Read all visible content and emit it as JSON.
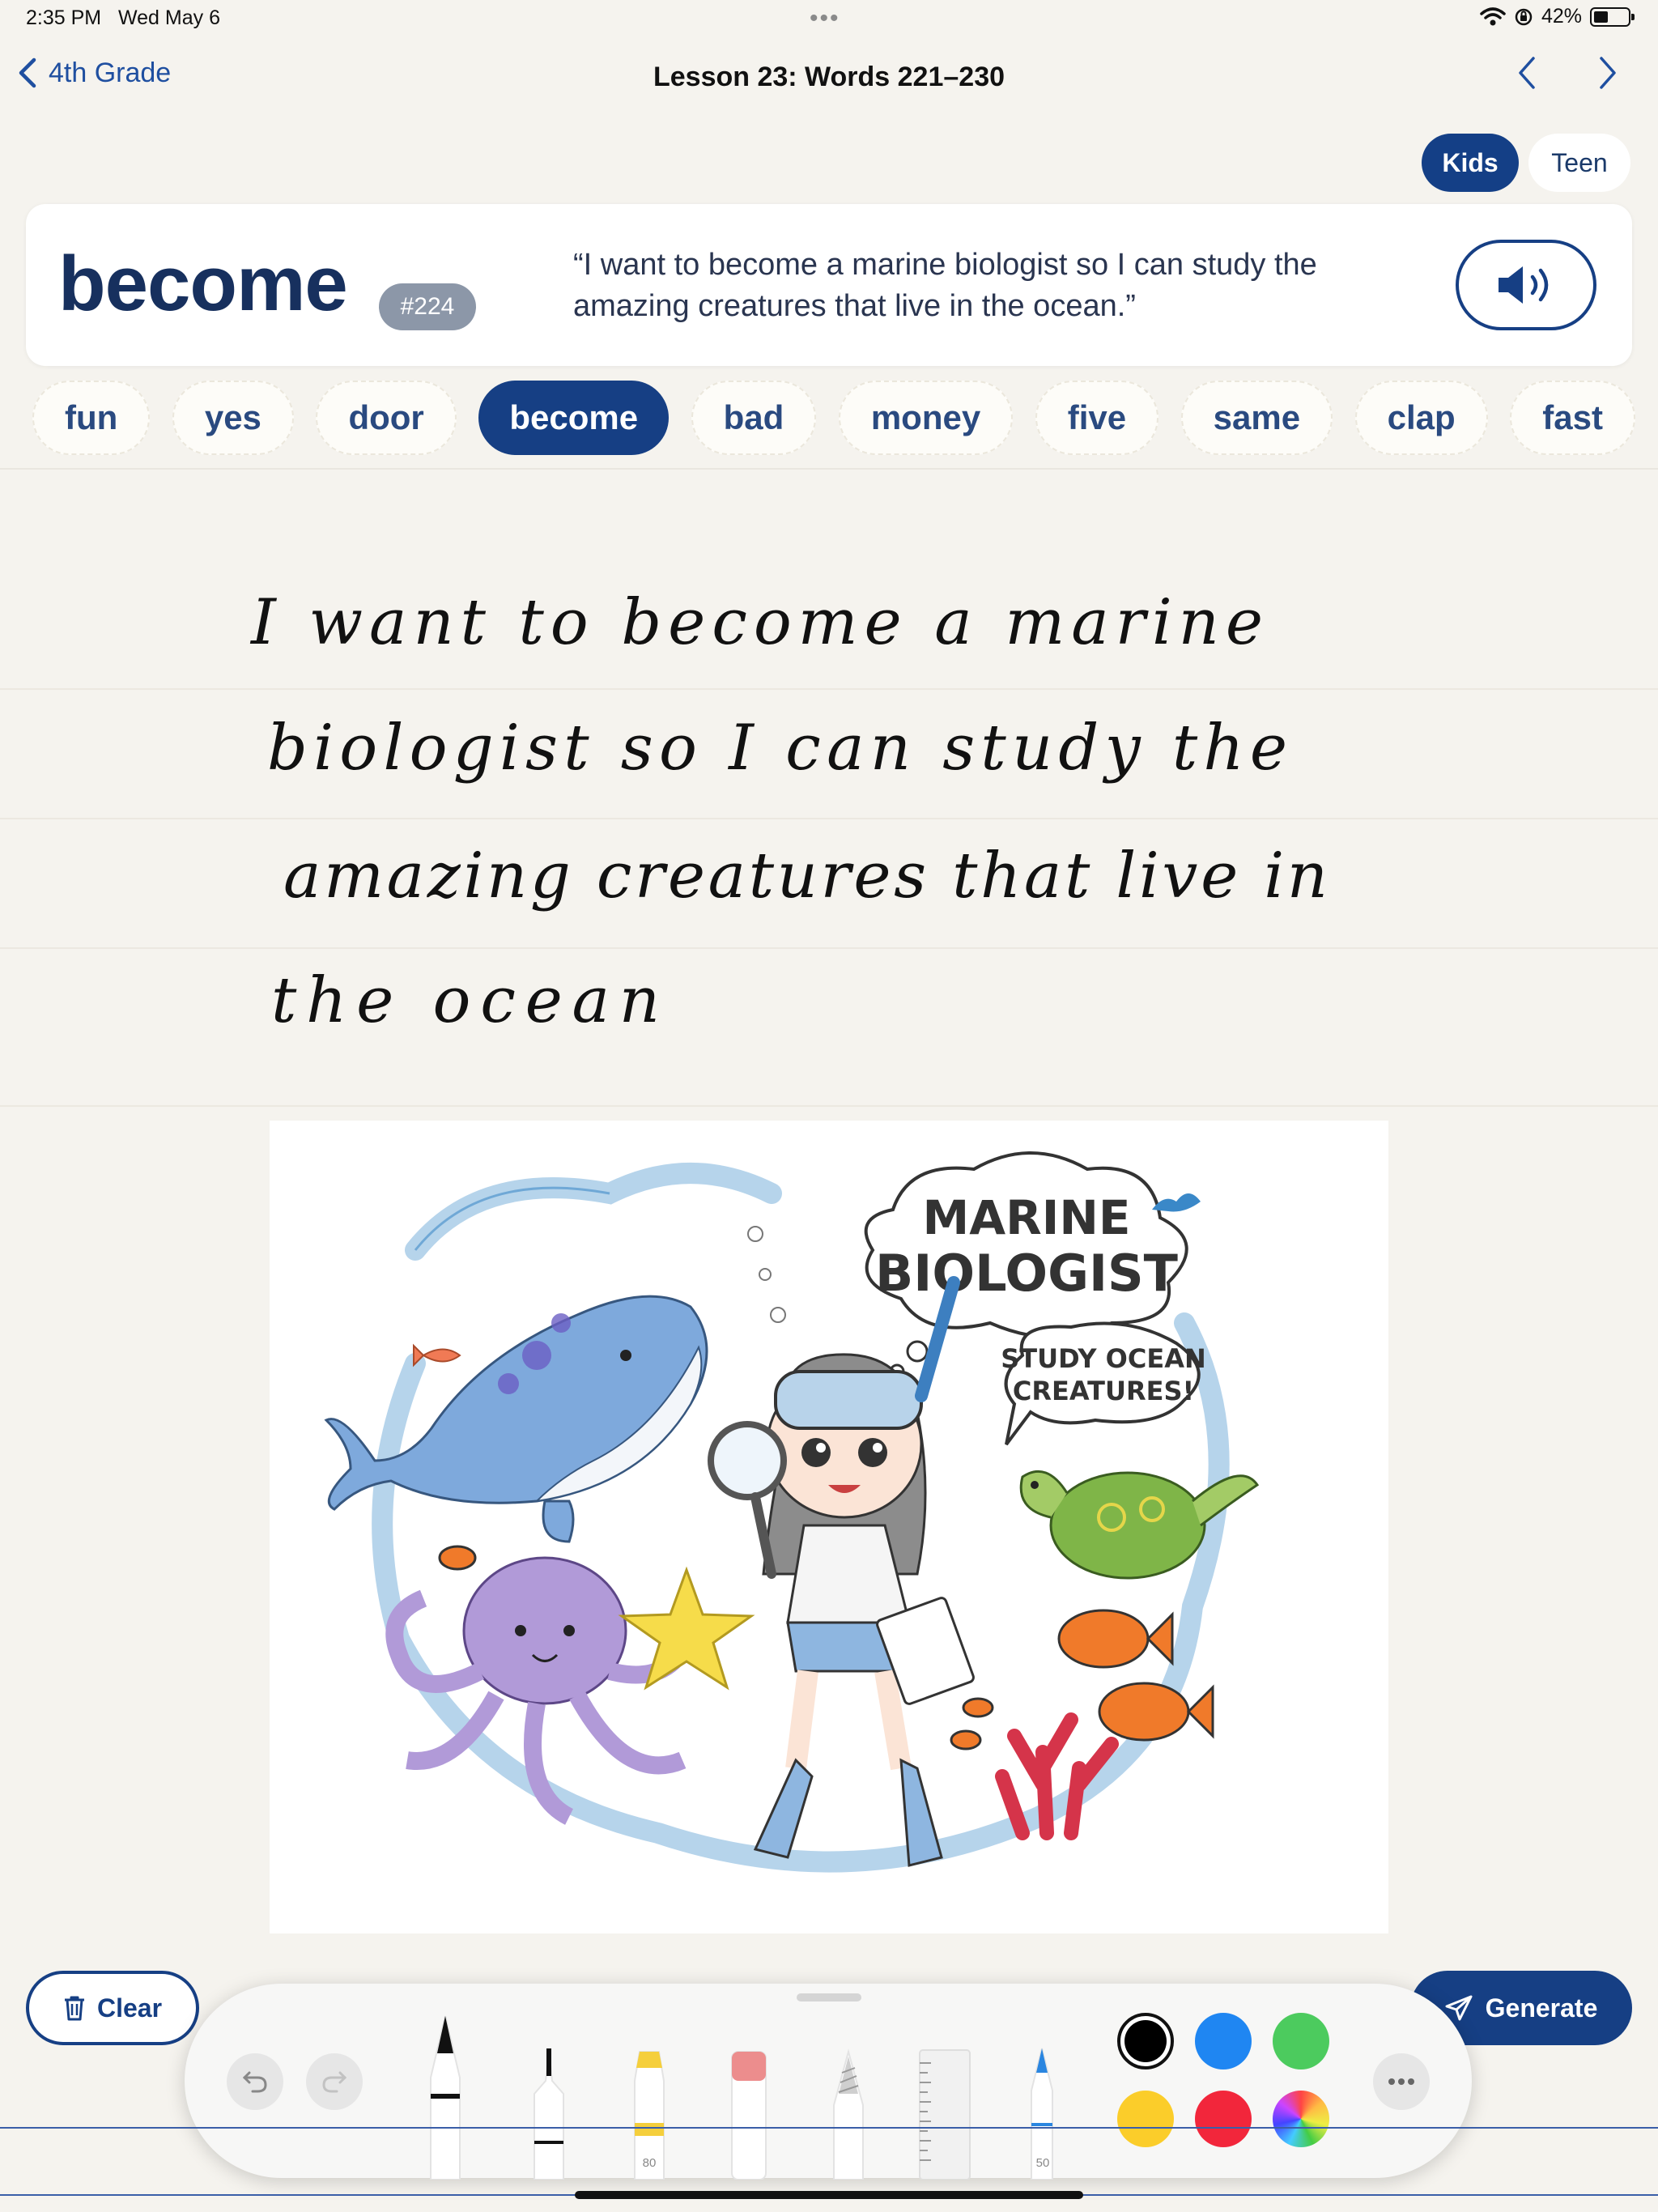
{
  "status": {
    "time": "2:35 PM",
    "date": "Wed May 6",
    "battery": "42%",
    "battery_level": 0.42
  },
  "nav": {
    "back_label": "4th Grade",
    "title": "Lesson 23: Words 221–230"
  },
  "mode": {
    "kids": "Kids",
    "teen": "Teen",
    "selected": "Kids"
  },
  "word": {
    "text": "become",
    "number": "#224",
    "sentence": "“I want to become a marine biologist so I can study the amazing creatures that live in the ocean.”"
  },
  "words": [
    "fun",
    "yes",
    "door",
    "become",
    "bad",
    "money",
    "five",
    "same",
    "clap",
    "fast"
  ],
  "selected_word": "become",
  "handwriting": {
    "lines": [
      "I want to become a marine",
      "biologist so I can study the",
      "amazing creatures that live in",
      "the ocean"
    ]
  },
  "illustration": {
    "title_line1": "MARINE",
    "title_line2": "BIOLOGIST",
    "caption_line1": "STUDY OCEAN",
    "caption_line2": "CREATURES!"
  },
  "actions": {
    "clear": "Clear",
    "generate": "Generate"
  },
  "tools": {
    "highlighter_size": "80",
    "crayon_size": "50",
    "colors": [
      "#000000",
      "#1f86f2",
      "#4ccb5e",
      "#fbcd2a",
      "#f2263b"
    ],
    "selected_color": "#000000"
  }
}
